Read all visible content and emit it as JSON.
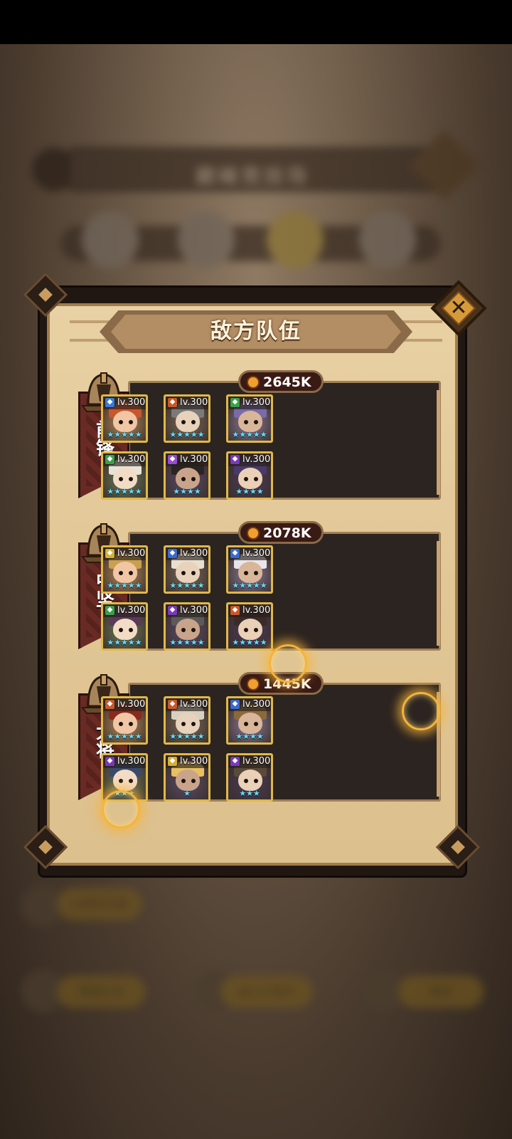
{
  "background": {
    "title": "巅峰竞技场",
    "buttons": [
      "以前的记录",
      "奖励汇总",
      "战斗力显示",
      "商店"
    ]
  },
  "panel": {
    "title": "敌方队伍",
    "close_icon": "close-x-icon"
  },
  "teams": [
    {
      "label": "前锋",
      "power": "2645K",
      "heroes": [
        {
          "level": "lv.300",
          "faction": "holy",
          "stars": "★★★★★"
        },
        {
          "level": "lv.300",
          "faction": "fire",
          "stars": "★★★★★"
        },
        {
          "level": "lv.300",
          "faction": "nature",
          "stars": "★★★★★"
        },
        {
          "level": "lv.300",
          "faction": "nature",
          "stars": "★★★★★"
        },
        {
          "level": "lv.300",
          "faction": "arcane",
          "stars": "★★★★"
        },
        {
          "level": "lv.300",
          "faction": "shadow",
          "stars": "★★★★"
        }
      ]
    },
    {
      "label": "中坚",
      "power": "2078K",
      "heroes": [
        {
          "level": "lv.300",
          "faction": "light",
          "stars": "★★★★★"
        },
        {
          "level": "lv.300",
          "faction": "water",
          "stars": "★★★★★"
        },
        {
          "level": "lv.300",
          "faction": "water",
          "stars": "★★★★★"
        },
        {
          "level": "lv.300",
          "faction": "nature",
          "stars": "★★★★★"
        },
        {
          "level": "lv.300",
          "faction": "shadow",
          "stars": "★★★★★"
        },
        {
          "level": "lv.300",
          "faction": "fire",
          "stars": "★★★★★"
        }
      ]
    },
    {
      "label": "大将",
      "power": "1445K",
      "heroes": [
        {
          "level": "lv.300",
          "faction": "fire",
          "stars": "★★★★★"
        },
        {
          "level": "lv.300",
          "faction": "fire",
          "stars": "★★★★★"
        },
        {
          "level": "lv.300",
          "faction": "water",
          "stars": "★★★★"
        },
        {
          "level": "lv.300",
          "faction": "shadow",
          "stars": "★★★"
        },
        {
          "level": "lv.300",
          "faction": "light",
          "stars": "★"
        },
        {
          "level": "lv.300",
          "faction": "shadow",
          "stars": "★★★"
        }
      ]
    }
  ],
  "colors": {
    "panel_bg": "#e2c796",
    "row_bg": "#2c2420",
    "banner": "#6a2a24",
    "card_border": "#e0b84a",
    "star": "#6fd8f0",
    "faction_holy": "#3a7ad8",
    "faction_fire": "#c8582a",
    "faction_nature": "#3aa04a",
    "faction_arcane": "#9a4ad0",
    "faction_shadow": "#7a3ab8",
    "faction_light": "#d8b030",
    "faction_water": "#3a6ad0"
  }
}
